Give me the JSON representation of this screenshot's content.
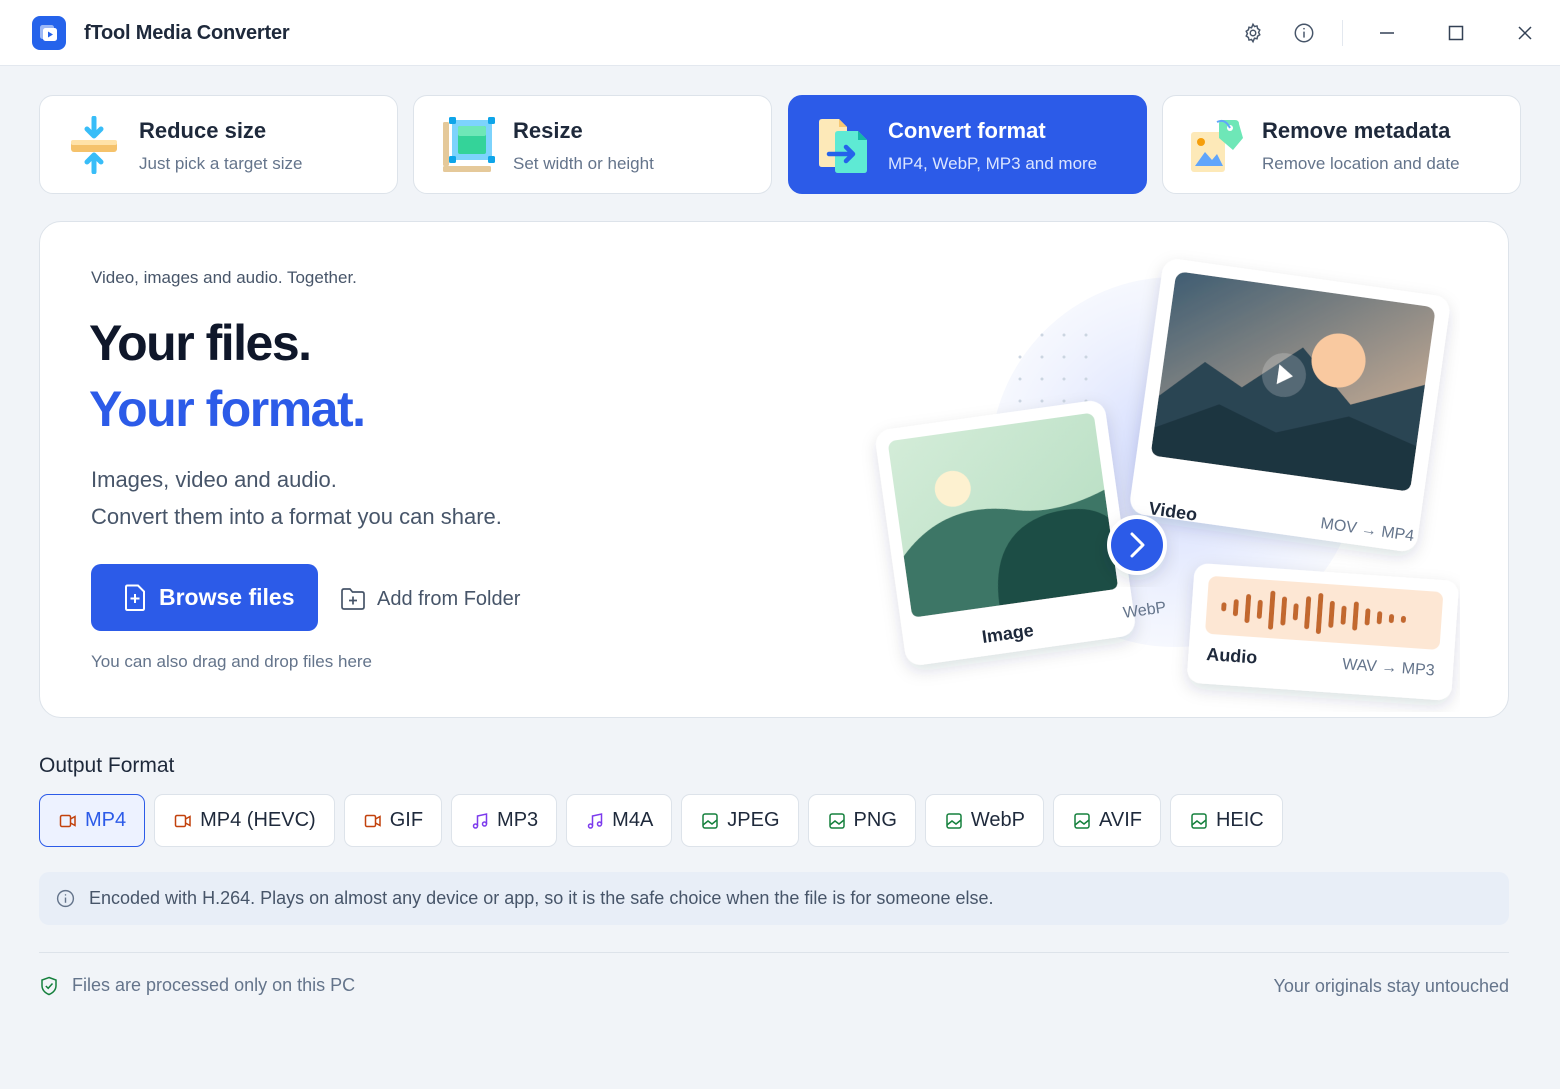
{
  "app": {
    "title": "fTool Media Converter",
    "accent": "#2c5be8"
  },
  "titlebar": {
    "icons": [
      "gear-icon",
      "info-icon",
      "minimize-icon",
      "maximize-icon",
      "close-icon"
    ]
  },
  "modes": [
    {
      "title": "Reduce size",
      "subtitle": "Just pick a target size",
      "icon": "compress-icon",
      "active": false
    },
    {
      "title": "Resize",
      "subtitle": "Set width or height",
      "icon": "resize-icon",
      "active": false
    },
    {
      "title": "Convert format",
      "subtitle": "MP4, WebP, MP3 and more",
      "icon": "convert-icon",
      "active": true
    },
    {
      "title": "Remove metadata",
      "subtitle": "Remove location and date",
      "icon": "metadata-tag-icon",
      "active": false
    }
  ],
  "hero": {
    "eyebrow": "Video, images and audio. Together.",
    "headline_line1": "Your files.",
    "headline_line2": "Your format.",
    "description_line1": "Images, video and audio.",
    "description_line2": "Convert them into a format you can share.",
    "browse_label": "Browse files",
    "folder_label": "Add from Folder",
    "drag_hint": "You can also drag and drop files here",
    "illustration": {
      "video_label": "Video",
      "video_conversion": "MOV → MP4",
      "image_label": "Image",
      "image_format": "WebP",
      "audio_label": "Audio",
      "audio_conversion": "WAV → MP3"
    }
  },
  "output_format": {
    "title": "Output Format",
    "selected": "MP4",
    "options": [
      {
        "label": "MP4",
        "kind": "video",
        "icon": "video-icon"
      },
      {
        "label": "MP4 (HEVC)",
        "kind": "video",
        "icon": "video-icon"
      },
      {
        "label": "GIF",
        "kind": "video",
        "icon": "video-icon"
      },
      {
        "label": "MP3",
        "kind": "audio",
        "icon": "music-note-icon"
      },
      {
        "label": "M4A",
        "kind": "audio",
        "icon": "music-note-icon"
      },
      {
        "label": "JPEG",
        "kind": "image",
        "icon": "image-icon"
      },
      {
        "label": "PNG",
        "kind": "image",
        "icon": "image-icon"
      },
      {
        "label": "WebP",
        "kind": "image",
        "icon": "image-icon"
      },
      {
        "label": "AVIF",
        "kind": "image",
        "icon": "image-icon"
      },
      {
        "label": "HEIC",
        "kind": "image",
        "icon": "image-icon"
      }
    ],
    "info_text": "Encoded with H.264. Plays on almost any device or app, so it is the safe choice when the file is for someone else."
  },
  "footer": {
    "left": "Files are processed only on this PC",
    "right": "Your originals stay untouched"
  }
}
